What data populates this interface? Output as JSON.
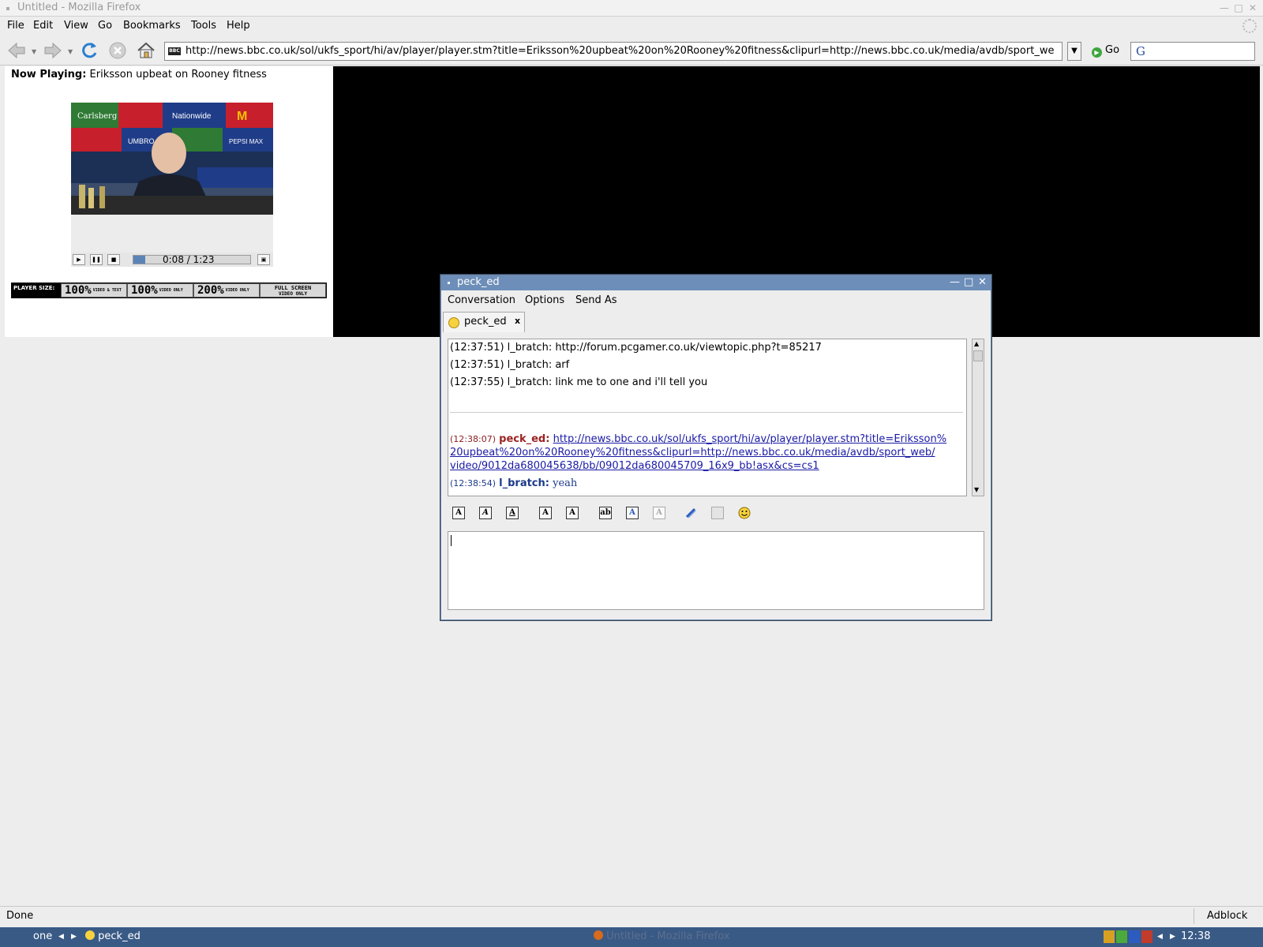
{
  "firefox": {
    "window_title": "Untitled - Mozilla Firefox",
    "menu": [
      "File",
      "Edit",
      "View",
      "Go",
      "Bookmarks",
      "Tools",
      "Help"
    ],
    "menu_mnemonics": [
      "F",
      "E",
      "V",
      "G",
      "B",
      "T",
      "H"
    ],
    "url": "http://news.bbc.co.uk/sol/ukfs_sport/hi/av/player/player.stm?title=Eriksson%20upbeat%20on%20Rooney%20fitness&clipurl=http://news.bbc.co.uk/media/avdb/sport_web/videc",
    "favicon_text": "BBC",
    "go_label": "Go",
    "search_logo": "G",
    "status_text": "Done",
    "adblock_label": "Adblock"
  },
  "player": {
    "now_playing_label": "Now Playing:",
    "now_playing_title": "Eriksson upbeat on Rooney fitness",
    "elapsed": "0:08",
    "duration": "1:23",
    "timecode": "0:08 /  1:23",
    "progress_fraction": 0.1,
    "size_label": "PLAYER SIZE:",
    "size_options": [
      {
        "big": "100%",
        "small": "VIDEO & TEXT"
      },
      {
        "big": "100%",
        "small": "VIDEO ONLY"
      },
      {
        "big": "200%",
        "small": "VIDEO ONLY"
      },
      {
        "big": "",
        "small": "FULL SCREEN VIDEO ONLY"
      }
    ],
    "full_screen_label": "FULL SCREEN",
    "video_only_label": "VIDEO ONLY",
    "video_banner_words": [
      "Carlsberg",
      "Nationwide",
      "UMBRO",
      "PEPSI MAX",
      "M"
    ]
  },
  "conversation": {
    "window_title": "peck_ed",
    "menu": [
      "Conversation",
      "Options",
      "Send As"
    ],
    "tab_label": "peck_ed",
    "tab_close": "x",
    "history": [
      {
        "text": "(12:37:51) l_bratch: http://forum.pcgamer.co.uk/viewtopic.php?t=85217"
      },
      {
        "text": "(12:37:51) l_bratch: arf"
      },
      {
        "text": "(12:37:55) l_bratch: link me to one and i'll tell you"
      }
    ],
    "msg1": {
      "time": "(12:38:07)",
      "nick": "peck_ed:",
      "link_lines": [
        "http://news.bbc.co.uk/sol/ukfs_sport/hi/av/player/player.stm?title=Eriksson%",
        "20upbeat%20on%20Rooney%20fitness&clipurl=http://news.bbc.co.uk/media/avdb/sport_web/",
        "video/9012da680045638/bb/09012da680045709_16x9_bb!asx&cs=cs1"
      ]
    },
    "msg2": {
      "time": "(12:38:54)",
      "nick": "l_bratch:",
      "text": "yeah"
    },
    "format_buttons": [
      "A",
      "A",
      "A",
      "A",
      "A",
      "ab",
      "A",
      "A"
    ]
  },
  "taskbar": {
    "workspace": "one",
    "pidgin_item": "peck_ed",
    "firefox_item": "Untitled - Mozilla Firefox",
    "clock": "12:38"
  },
  "colors": {
    "title_active": "#6d8eb8",
    "taskbar": "#3a5a86",
    "link": "#1a1aa6",
    "nick_red": "#9c2222",
    "nick_blue": "#1c3a8a"
  }
}
